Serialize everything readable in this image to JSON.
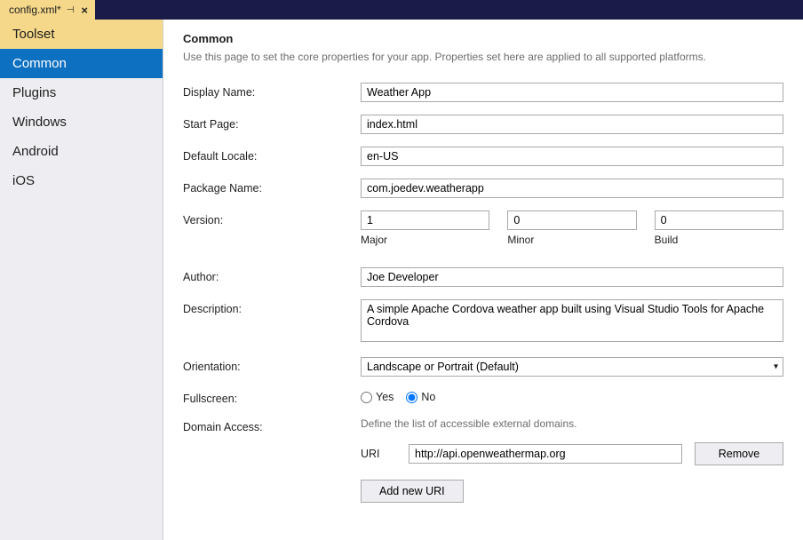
{
  "tab": {
    "title": "config.xml*"
  },
  "sidebar": {
    "items": [
      {
        "label": "Toolset"
      },
      {
        "label": "Common"
      },
      {
        "label": "Plugins"
      },
      {
        "label": "Windows"
      },
      {
        "label": "Android"
      },
      {
        "label": "iOS"
      }
    ]
  },
  "page": {
    "header": "Common",
    "description": "Use this page to set the core properties for your app. Properties set here are applied to all supported platforms."
  },
  "labels": {
    "displayName": "Display Name:",
    "startPage": "Start Page:",
    "defaultLocale": "Default Locale:",
    "packageName": "Package Name:",
    "version": "Version:",
    "major": "Major",
    "minor": "Minor",
    "build": "Build",
    "author": "Author:",
    "description": "Description:",
    "orientation": "Orientation:",
    "fullscreen": "Fullscreen:",
    "yes": "Yes",
    "no": "No",
    "domainAccess": "Domain Access:",
    "domainHint": "Define the list of accessible external domains.",
    "uri": "URI",
    "remove": "Remove",
    "addUri": "Add new URI"
  },
  "values": {
    "displayName": "Weather App",
    "startPage": "index.html",
    "defaultLocale": "en-US",
    "packageName": "com.joedev.weatherapp",
    "versionMajor": "1",
    "versionMinor": "0",
    "versionBuild": "0",
    "author": "Joe Developer",
    "description": "A simple Apache Cordova weather app built using Visual Studio Tools for Apache Cordova",
    "orientation": "Landscape or Portrait (Default)",
    "fullscreen": "No",
    "uri": "http://api.openweathermap.org"
  }
}
